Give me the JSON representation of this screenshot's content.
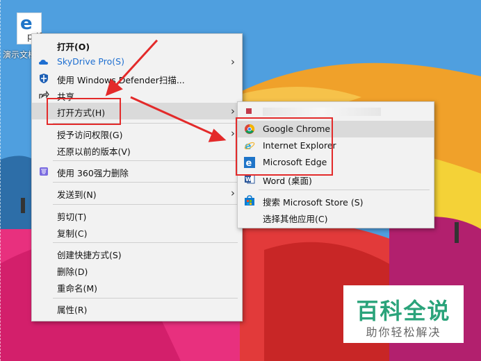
{
  "desktop": {
    "file_icon_letter": "e",
    "file_icon_ext": "pdf",
    "file_name": "演示文档"
  },
  "main_menu": {
    "items": [
      {
        "label": "打开(O)"
      },
      {
        "label": "SkyDrive Pro(S)",
        "icon": "skydrive-cloud-icon"
      },
      {
        "label": "使用 Windows Defender扫描...",
        "icon": "windows-defender-shield-icon"
      },
      {
        "label": "共享",
        "icon": "share-icon"
      },
      {
        "label": "打开方式(H)"
      },
      {
        "label": "授予访问权限(G)"
      },
      {
        "label": "还原以前的版本(V)"
      },
      {
        "label": "使用 360强力删除",
        "icon": "360-delete-icon"
      },
      {
        "label": "发送到(N)"
      },
      {
        "label": "剪切(T)"
      },
      {
        "label": "复制(C)"
      },
      {
        "label": "创建快捷方式(S)"
      },
      {
        "label": "删除(D)"
      },
      {
        "label": "重命名(M)"
      },
      {
        "label": "属性(R)"
      }
    ]
  },
  "open_with_menu": {
    "items": [
      {
        "label": "Google Chrome",
        "icon": "chrome-icon"
      },
      {
        "label": "Internet Explorer",
        "icon": "internet-explorer-icon"
      },
      {
        "label": "Microsoft Edge",
        "icon": "edge-icon"
      },
      {
        "label": "Word (桌面)",
        "icon": "word-icon"
      },
      {
        "label": "搜索 Microsoft Store (S)",
        "icon": "store-icon"
      },
      {
        "label": "选择其他应用(C)"
      }
    ]
  },
  "watermark": {
    "title": "百科全说",
    "subtitle": "助你轻松解决"
  },
  "colors": {
    "highlight": "#dadada",
    "annotation_red": "#e32a2a",
    "watermark_green": "#2aa37a",
    "skydrive_blue": "#1e6fd1"
  }
}
